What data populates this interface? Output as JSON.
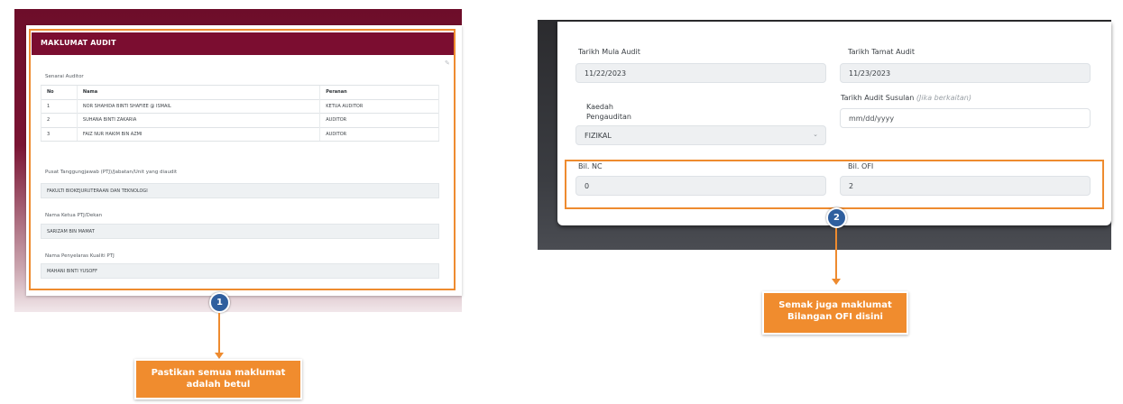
{
  "left_form": {
    "header_title": "MAKLUMAT AUDIT",
    "auditor_list_label": "Senarai Auditor",
    "table": {
      "headers": [
        "No",
        "Nama",
        "Peranan"
      ],
      "rows": [
        [
          "1",
          "NOR SHAHIDA BINTI SHAFIEE @ ISMAIL",
          "KETUA AUDITOR"
        ],
        [
          "2",
          "SUHANA BINTI ZAKARIA",
          "AUDITOR"
        ],
        [
          "3",
          "FAIZ NUR HAKIM BIN AZMI",
          "AUDITOR"
        ]
      ]
    },
    "ptj_label": "Pusat Tanggungjawab (PTJ)/Jabatan/Unit yang diaudit",
    "ptj_value": "FAKULTI BIOKEJURUTERAAN DAN TEKNOLOGI",
    "head_label": "Nama Ketua PTJ/Dekan",
    "head_value": "SARIZAM BIN MAMAT",
    "coordinator_label": "Nama Penyelaras Kualiti PTJ",
    "coordinator_value": "MAHANI BINTI YUSOFF"
  },
  "right_form": {
    "start_label": "Tarikh Mula Audit",
    "start_value": "11/22/2023",
    "end_label": "Tarikh Tamat Audit",
    "end_value": "11/23/2023",
    "method_label_line1": "Kaedah",
    "method_label_line2": "Pengauditan",
    "method_value": "FIZIKAL",
    "followup_label": "Tarikh Audit Susulan",
    "followup_hint": "(Jika berkaitan)",
    "followup_placeholder": "mm/dd/yyyy",
    "nc_label": "Bil. NC",
    "nc_value": "0",
    "ofi_label": "Bil. OFI",
    "ofi_value": "2"
  },
  "annotations": {
    "badge1": "1",
    "callout1_line1": "Pastikan semua maklumat",
    "callout1_line2": "adalah betul",
    "badge2": "2",
    "callout2_line1": "Semak juga maklumat",
    "callout2_line2": "Bilangan OFI disini"
  },
  "colors": {
    "header_maroon": "#7b0d30",
    "highlight_orange": "#ee8b2f",
    "badge_blue": "#2f5f9e"
  }
}
